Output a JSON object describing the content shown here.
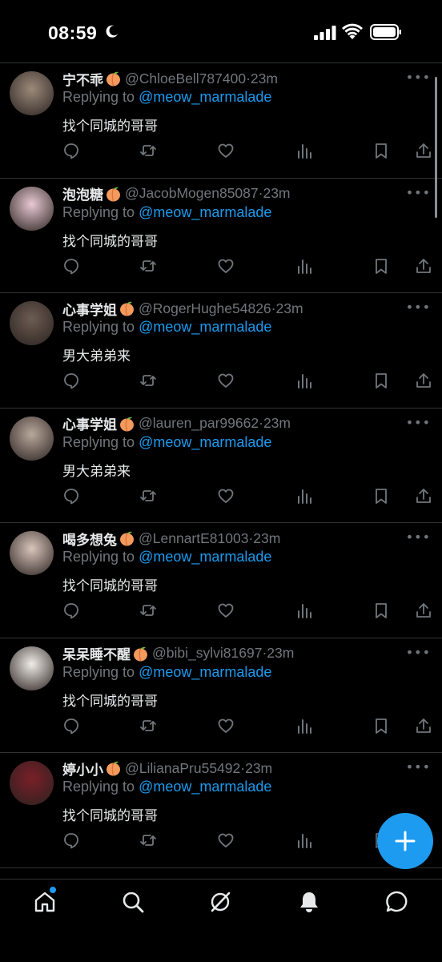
{
  "status_bar": {
    "time": "08:59"
  },
  "reply_prefix": "Replying to",
  "tweets": [
    {
      "name": "宁不乖",
      "handle": "@ChloeBell787400",
      "time": "23m",
      "reply_to": "@meow_marmalade",
      "text": "找个同城的哥哥",
      "avatar_color": "#9b8a7a"
    },
    {
      "name": "泡泡糖",
      "handle": "@JacobMogen85087",
      "time": "23m",
      "reply_to": "@meow_marmalade",
      "text": "找个同城的哥哥",
      "avatar_color": "#e8c9d4"
    },
    {
      "name": "心事学姐",
      "handle": "@RogerHughe54826",
      "time": "23m",
      "reply_to": "@meow_marmalade",
      "text": "男大弟弟来",
      "avatar_color": "#6d5c52"
    },
    {
      "name": "心事学姐",
      "handle": "@lauren_par99662",
      "time": "23m",
      "reply_to": "@meow_marmalade",
      "text": "男大弟弟来",
      "avatar_color": "#b9a89c"
    },
    {
      "name": "喝多想兔",
      "handle": "@LennartE81003",
      "time": "23m",
      "reply_to": "@meow_marmalade",
      "text": "找个同城的哥哥",
      "avatar_color": "#d9c5bb"
    },
    {
      "name": "呆呆睡不醒",
      "handle": "@bibi_sylvi81697",
      "time": "23m",
      "reply_to": "@meow_marmalade",
      "text": "找个同城的哥哥",
      "avatar_color": "#f0ece8"
    },
    {
      "name": "婷小小",
      "handle": "@LilianaPru55492",
      "time": "23m",
      "reply_to": "@meow_marmalade",
      "text": "找个同城的哥哥",
      "avatar_color": "#7a1f28"
    }
  ],
  "colors": {
    "accent": "#1d9bf0",
    "muted": "#71767b",
    "text": "#e7e9ea",
    "background": "#000000"
  },
  "icons": {
    "actions": [
      "reply-icon",
      "retweet-icon",
      "like-icon",
      "views-icon",
      "bookmark-icon",
      "share-icon"
    ],
    "tabs": [
      "home-icon",
      "search-icon",
      "grok-icon",
      "notifications-icon",
      "messages-icon"
    ],
    "fab": "plus-icon"
  }
}
